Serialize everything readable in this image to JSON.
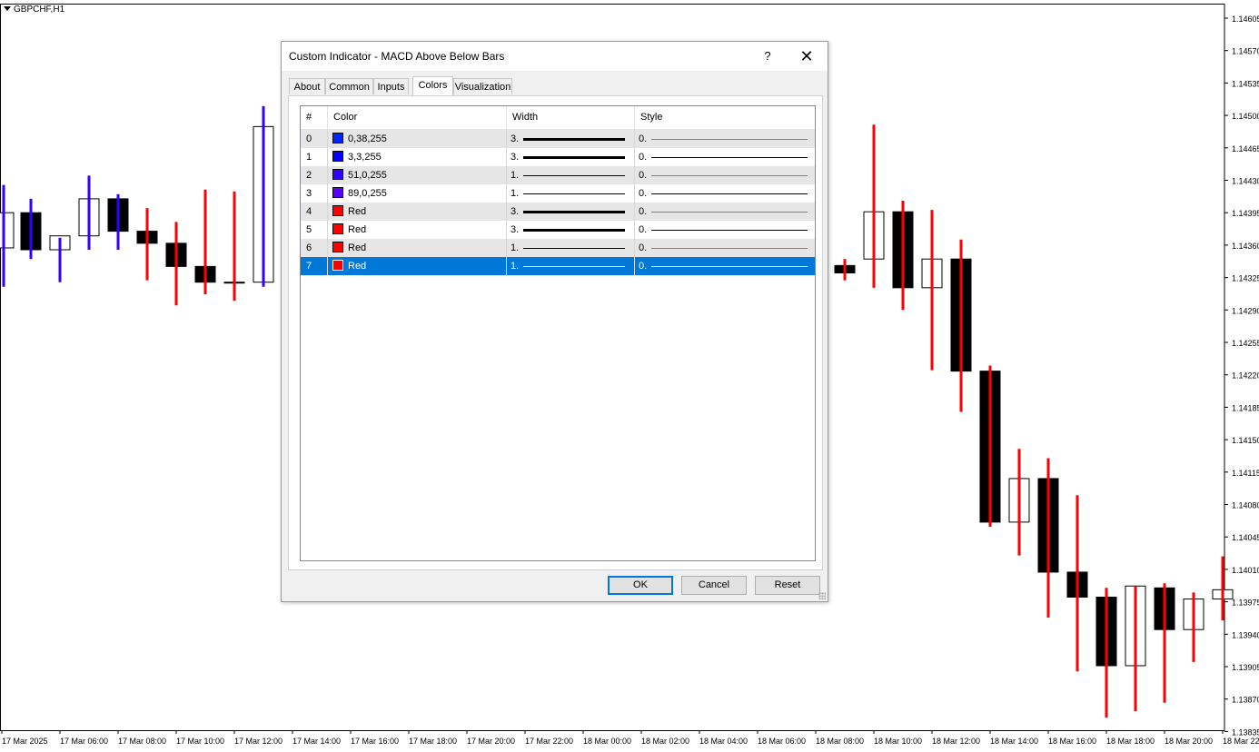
{
  "chart": {
    "symbol": "GBPCHF,H1",
    "price_ticks": [
      "1.14605",
      "1.14570",
      "1.14535",
      "1.14500",
      "1.14465",
      "1.14430",
      "1.14395",
      "1.14360",
      "1.14325",
      "1.14290",
      "1.14255",
      "1.14220",
      "1.14185",
      "1.14150",
      "1.14115",
      "1.14080",
      "1.14045",
      "1.14010",
      "1.13975",
      "1.13940",
      "1.13905",
      "1.13870",
      "1.13835"
    ],
    "time_ticks": [
      "17 Mar 2025",
      "17 Mar 06:00",
      "17 Mar 08:00",
      "17 Mar 10:00",
      "17 Mar 12:00",
      "17 Mar 14:00",
      "17 Mar 16:00",
      "17 Mar 18:00",
      "17 Mar 20:00",
      "17 Mar 22:00",
      "18 Mar 00:00",
      "18 Mar 02:00",
      "18 Mar 04:00",
      "18 Mar 06:00",
      "18 Mar 08:00",
      "18 Mar 10:00",
      "18 Mar 12:00",
      "18 Mar 14:00",
      "18 Mar 16:00",
      "18 Mar 18:00",
      "18 Mar 20:00",
      "18 Mar 22:00"
    ],
    "colors": {
      "bull_bar": "#3300ff",
      "bear_bar": "#ff0000",
      "candle_body_dark": "#000000",
      "candle_body_light": "#ffffff"
    },
    "candles": [
      {
        "o": 1.14357,
        "h": 1.14425,
        "l": 1.14315,
        "c": 1.14395,
        "dir": "up"
      },
      {
        "o": 1.14395,
        "h": 1.1441,
        "l": 1.14345,
        "c": 1.14355,
        "dir": "up"
      },
      {
        "o": 1.14355,
        "h": 1.14368,
        "l": 1.1432,
        "c": 1.1437,
        "dir": "up"
      },
      {
        "o": 1.1437,
        "h": 1.14435,
        "l": 1.14355,
        "c": 1.1441,
        "dir": "up"
      },
      {
        "o": 1.1441,
        "h": 1.14415,
        "l": 1.14355,
        "c": 1.14375,
        "dir": "up"
      },
      {
        "o": 1.14375,
        "h": 1.144,
        "l": 1.14322,
        "c": 1.14362,
        "dir": "down"
      },
      {
        "o": 1.14362,
        "h": 1.14385,
        "l": 1.14295,
        "c": 1.14337,
        "dir": "down"
      },
      {
        "o": 1.14337,
        "h": 1.1442,
        "l": 1.14307,
        "c": 1.1432,
        "dir": "down"
      },
      {
        "o": 1.1432,
        "h": 1.14418,
        "l": 1.143,
        "c": 1.1432,
        "dir": "down"
      },
      {
        "o": 1.1432,
        "h": 1.1451,
        "l": 1.14315,
        "c": 1.14488,
        "dir": "up"
      },
      {
        "o": 1.14338,
        "h": 1.14345,
        "l": 1.14322,
        "c": 1.1433,
        "dir": "down"
      },
      {
        "o": 1.14345,
        "h": 1.1449,
        "l": 1.14314,
        "c": 1.14396,
        "dir": "down"
      },
      {
        "o": 1.14396,
        "h": 1.14408,
        "l": 1.1429,
        "c": 1.14314,
        "dir": "down"
      },
      {
        "o": 1.14314,
        "h": 1.14398,
        "l": 1.14225,
        "c": 1.14345,
        "dir": "down"
      },
      {
        "o": 1.14345,
        "h": 1.14366,
        "l": 1.1418,
        "c": 1.14224,
        "dir": "down"
      },
      {
        "o": 1.14224,
        "h": 1.1423,
        "l": 1.14056,
        "c": 1.14061,
        "dir": "down"
      },
      {
        "o": 1.14061,
        "h": 1.1414,
        "l": 1.14025,
        "c": 1.14108,
        "dir": "down"
      },
      {
        "o": 1.14108,
        "h": 1.1413,
        "l": 1.13958,
        "c": 1.14007,
        "dir": "down"
      },
      {
        "o": 1.14007,
        "h": 1.1409,
        "l": 1.139,
        "c": 1.1398,
        "dir": "down"
      },
      {
        "o": 1.1398,
        "h": 1.1399,
        "l": 1.1385,
        "c": 1.13906,
        "dir": "down"
      },
      {
        "o": 1.13906,
        "h": 1.13992,
        "l": 1.13857,
        "c": 1.13992,
        "dir": "down"
      },
      {
        "o": 1.1399,
        "h": 1.13995,
        "l": 1.13866,
        "c": 1.13945,
        "dir": "down"
      },
      {
        "o": 1.13945,
        "h": 1.13985,
        "l": 1.1391,
        "c": 1.13978,
        "dir": "down"
      },
      {
        "o": 1.13978,
        "h": 1.14024,
        "l": 1.13955,
        "c": 1.13988,
        "dir": "down"
      }
    ]
  },
  "dialog": {
    "title": "Custom Indicator - MACD Above Below Bars",
    "help_label": "?",
    "close_label": "✕",
    "tabs": [
      {
        "label": "About",
        "active": false
      },
      {
        "label": "Common",
        "active": false
      },
      {
        "label": "Inputs",
        "active": false
      },
      {
        "label": "Colors",
        "active": true
      },
      {
        "label": "Visualization",
        "active": false
      }
    ],
    "grid": {
      "headers": {
        "index": "#",
        "color": "Color",
        "width": "Width",
        "style": "Style"
      },
      "rows": [
        {
          "index": "0",
          "swatch": "#0026ff",
          "color": "0,38,255",
          "width": "3.",
          "style": "0.",
          "width_value": 3,
          "selected": false
        },
        {
          "index": "1",
          "swatch": "#0303ff",
          "color": "3,3,255",
          "width": "3.",
          "style": "0.",
          "width_value": 3,
          "selected": false
        },
        {
          "index": "2",
          "swatch": "#3300ff",
          "color": "51,0,255",
          "width": "1.",
          "style": "0.",
          "width_value": 1,
          "selected": false
        },
        {
          "index": "3",
          "swatch": "#5900ff",
          "color": "89,0,255",
          "width": "1.",
          "style": "0.",
          "width_value": 1,
          "selected": false
        },
        {
          "index": "4",
          "swatch": "#ff0000",
          "color": "Red",
          "width": "3.",
          "style": "0.",
          "width_value": 3,
          "selected": false
        },
        {
          "index": "5",
          "swatch": "#ff0000",
          "color": "Red",
          "width": "3.",
          "style": "0.",
          "width_value": 3,
          "selected": false
        },
        {
          "index": "6",
          "swatch": "#ff0000",
          "color": "Red",
          "width": "1.",
          "style": "0.",
          "width_value": 1,
          "selected": false
        },
        {
          "index": "7",
          "swatch": "#ff0000",
          "color": "Red",
          "width": "1.",
          "style": "0.",
          "width_value": 1,
          "selected": true
        }
      ]
    },
    "buttons": {
      "ok": "OK",
      "cancel": "Cancel",
      "reset": "Reset"
    },
    "selection_color": "#0078d7"
  }
}
